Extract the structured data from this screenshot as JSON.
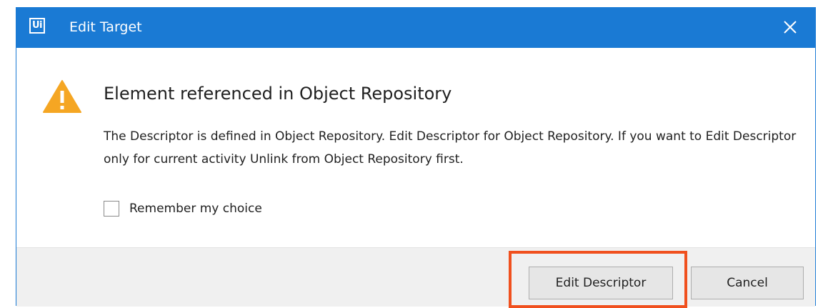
{
  "window": {
    "title": "Edit Target",
    "app_icon_text": "Ui"
  },
  "dialog": {
    "heading": "Element referenced in Object Repository",
    "message": "The Descriptor is defined in Object Repository. Edit Descriptor for Object Repository. If you want to Edit Descriptor only for current activity Unlink from Object Repository first.",
    "checkbox_label": "Remember my choice",
    "checkbox_checked": false
  },
  "buttons": {
    "edit_descriptor": "Edit Descriptor",
    "cancel": "Cancel"
  },
  "icons": {
    "warning": "warning-icon",
    "close": "close-icon",
    "app": "uipath-logo-icon"
  },
  "colors": {
    "titlebar": "#1a7ad4",
    "warning": "#f5a623",
    "highlight": "#f0501e",
    "footer": "#f0f0f0"
  }
}
